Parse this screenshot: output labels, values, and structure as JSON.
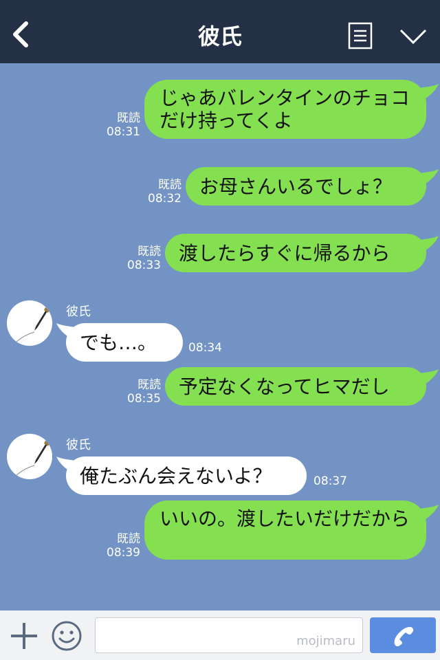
{
  "header": {
    "title": "彼氏"
  },
  "icons": {
    "back": "chevron-left-icon",
    "menu": "document-list-icon",
    "collapse": "chevron-down-icon",
    "add": "plus-icon",
    "emoji": "smile-icon",
    "call": "phone-icon"
  },
  "colors": {
    "header_bg": "#243045",
    "chat_bg": "#7293c4",
    "outgoing_bubble": "#84e051",
    "incoming_bubble": "#ffffff",
    "call_button": "#5a8de0"
  },
  "messages": [
    {
      "direction": "out",
      "text": "じゃあバレンタインのチョコだけ持ってくよ",
      "read": "既読",
      "time": "08:31"
    },
    {
      "direction": "out",
      "text": "お母さんいるでしょ？",
      "read": "既読",
      "time": "08:32"
    },
    {
      "direction": "out",
      "text": "渡したらすぐに帰るから",
      "read": "既読",
      "time": "08:33"
    },
    {
      "direction": "in",
      "sender": "彼氏",
      "text": "でも…。",
      "time": "08:34"
    },
    {
      "direction": "out",
      "text": "予定なくなってヒマだし",
      "read": "既読",
      "time": "08:35"
    },
    {
      "direction": "in",
      "sender": "彼氏",
      "text": "俺たぶん会えないよ？",
      "time": "08:37"
    },
    {
      "direction": "out",
      "text": "いいの。渡したいだけだから",
      "read": "既読",
      "time": "08:39"
    }
  ],
  "footer": {
    "input_value": "",
    "watermark": "mojimaru"
  }
}
